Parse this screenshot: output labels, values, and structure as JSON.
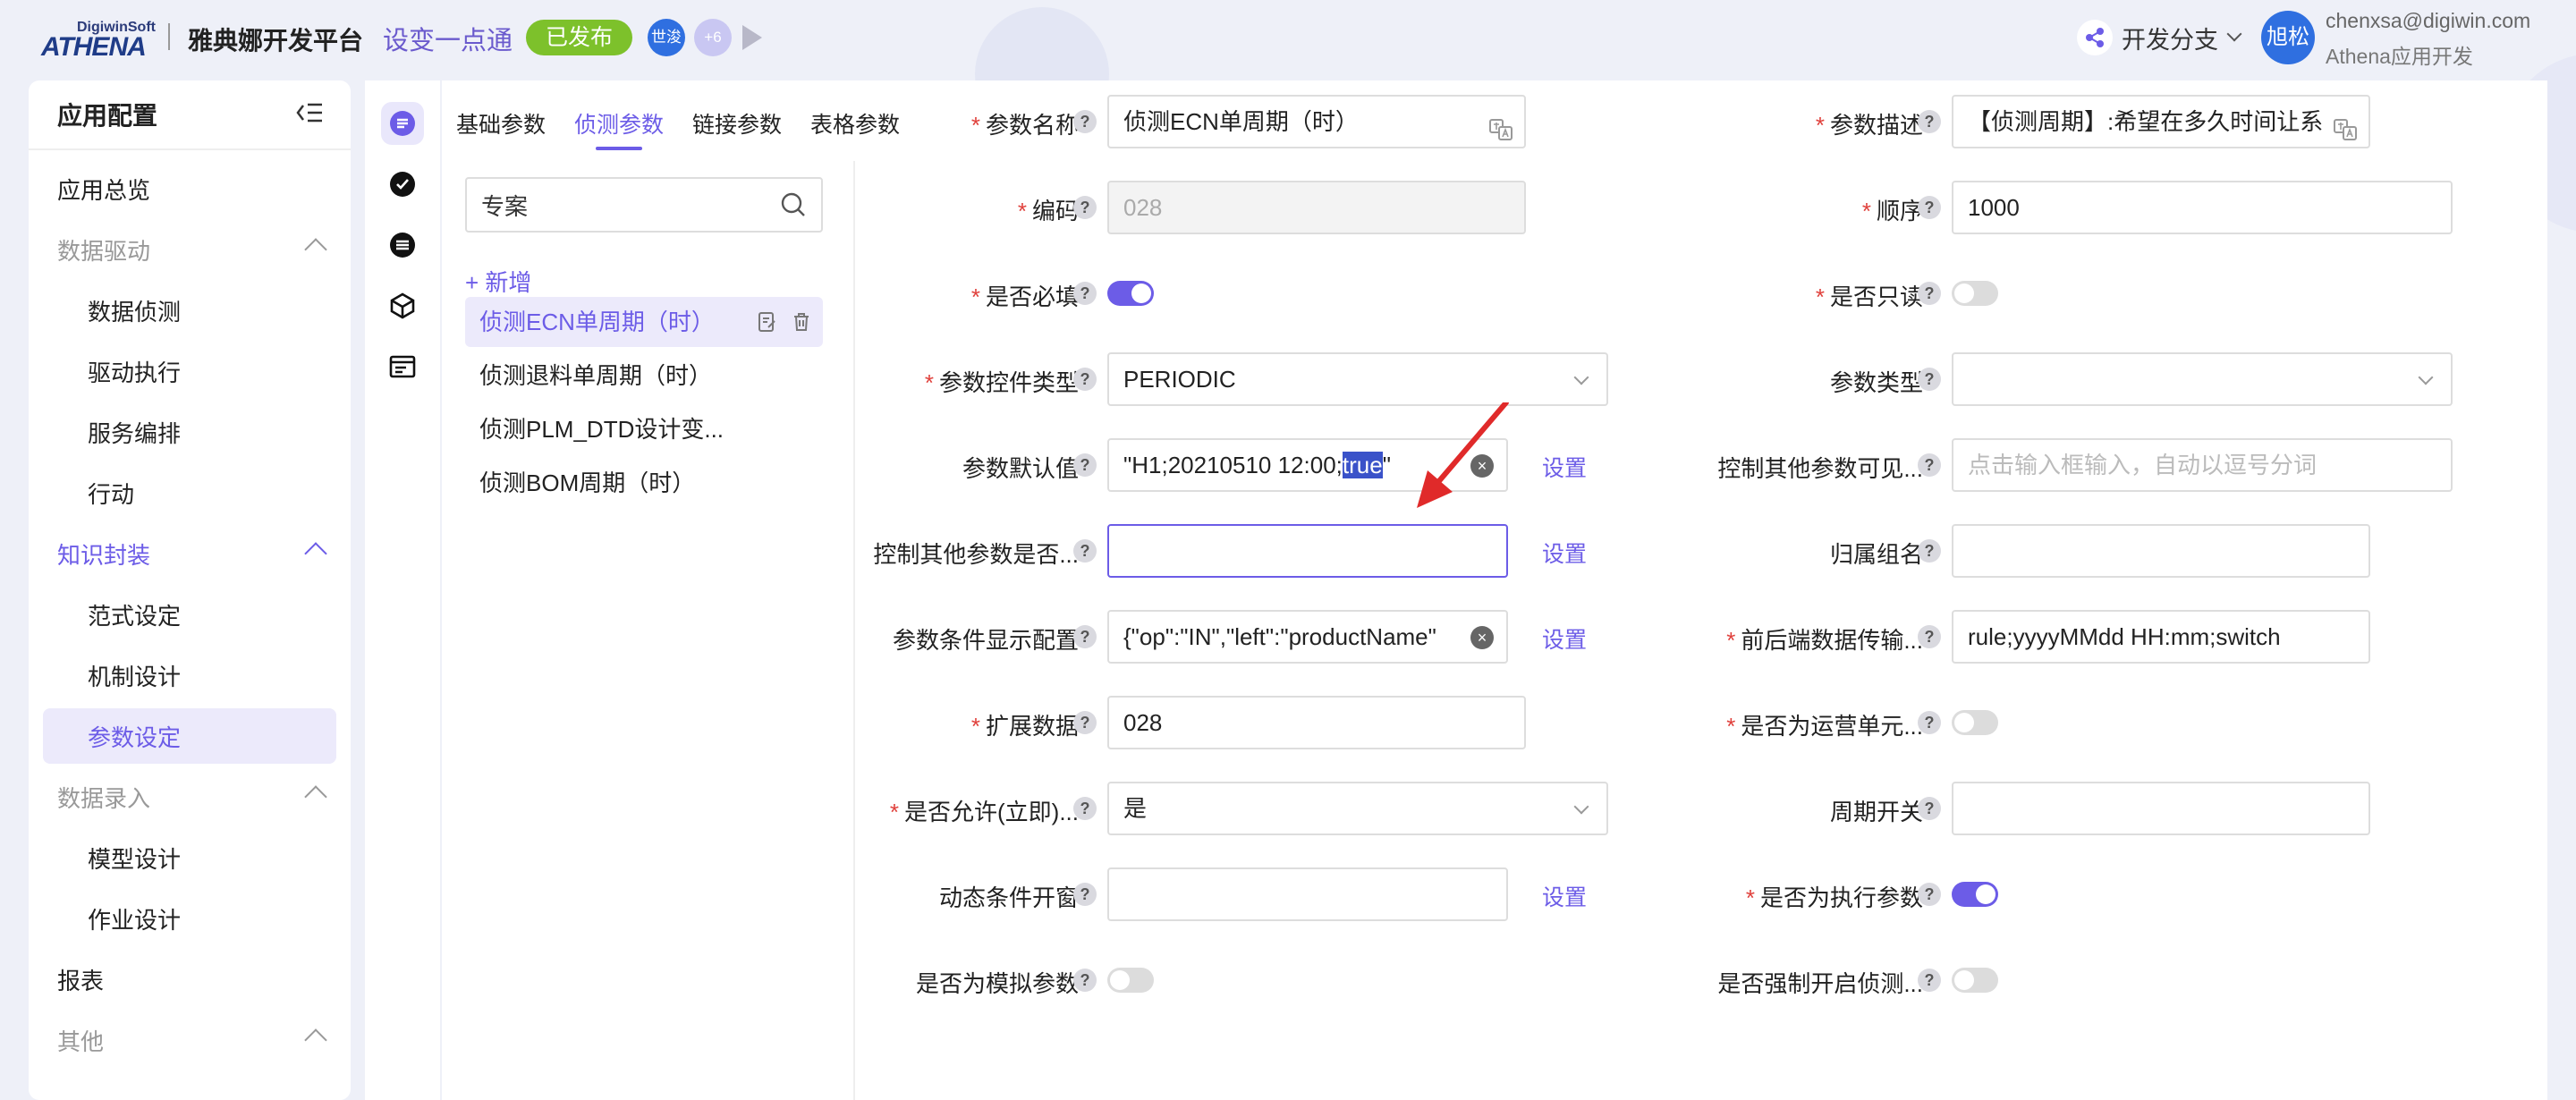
{
  "header": {
    "logo_small": "DigiwinSoft",
    "logo_big": "ATHENA",
    "platform": "雅典娜开发平台",
    "app_name": "设变一点通",
    "status_badge": "已发布",
    "avatar1": "世浚",
    "avatar_more": "+6",
    "branch_label": "开发分支",
    "user_avatar": "旭松",
    "user_email": "chenxsa@digiwin.com",
    "user_role": "Athena应用开发"
  },
  "sidebar": {
    "title": "应用配置",
    "items": [
      {
        "label": "应用总览",
        "kind": "item"
      },
      {
        "label": "数据驱动",
        "kind": "group"
      },
      {
        "label": "数据侦测",
        "kind": "sub"
      },
      {
        "label": "驱动执行",
        "kind": "sub"
      },
      {
        "label": "服务编排",
        "kind": "sub"
      },
      {
        "label": "行动",
        "kind": "sub"
      },
      {
        "label": "知识封装",
        "kind": "group-active"
      },
      {
        "label": "范式设定",
        "kind": "sub"
      },
      {
        "label": "机制设计",
        "kind": "sub"
      },
      {
        "label": "参数设定",
        "kind": "sub-selected"
      },
      {
        "label": "数据录入",
        "kind": "group"
      },
      {
        "label": "模型设计",
        "kind": "sub"
      },
      {
        "label": "作业设计",
        "kind": "sub"
      },
      {
        "label": "报表",
        "kind": "item"
      },
      {
        "label": "其他",
        "kind": "group"
      }
    ]
  },
  "tabs": [
    "基础参数",
    "侦测参数",
    "链接参数",
    "表格参数"
  ],
  "search": {
    "value": "专案"
  },
  "add_label": "+ 新增",
  "params_list": [
    "侦测ECN单周期（时）",
    "侦测退料单周期（时）",
    "侦测PLM_DTD设计变...",
    "侦测BOM周期（时）"
  ],
  "form": {
    "left": [
      {
        "label": "参数名称",
        "required": true,
        "type": "text",
        "value": "侦测ECN单周期（时）",
        "translate": true
      },
      {
        "label": "编码",
        "required": true,
        "type": "disabled",
        "value": "028"
      },
      {
        "label": "是否必填",
        "required": true,
        "type": "toggle",
        "on": true
      },
      {
        "label": "参数控件类型",
        "required": true,
        "type": "select",
        "value": "PERIODIC"
      },
      {
        "label": "参数默认值",
        "required": false,
        "type": "clearable",
        "value_pre": "\"H1;20210510 12:00;",
        "value_hl": "true",
        "value_post": "\"",
        "setting": "设置"
      },
      {
        "label": "控制其他参数是否...",
        "required": false,
        "type": "focus",
        "value": "",
        "setting": "设置"
      },
      {
        "label": "参数条件显示配置",
        "required": false,
        "type": "clearable",
        "value_pre": "{\"op\":\"IN\",\"left\":\"productName\"",
        "value_hl": "",
        "value_post": "",
        "setting": "设置"
      },
      {
        "label": "扩展数据",
        "required": true,
        "type": "text",
        "value": "028"
      },
      {
        "label": "是否允许(立即)...",
        "required": true,
        "type": "select",
        "value": "是"
      },
      {
        "label": "动态条件开窗",
        "required": false,
        "type": "text",
        "value": "",
        "setting": "设置"
      },
      {
        "label": "是否为模拟参数",
        "required": false,
        "type": "toggle",
        "on": false
      }
    ],
    "right": [
      {
        "label": "参数描述",
        "required": true,
        "type": "text",
        "value": "【侦测周期】:希望在多久时间让系",
        "translate": true
      },
      {
        "label": "顺序",
        "required": true,
        "type": "text",
        "value": "1000"
      },
      {
        "label": "是否只读",
        "required": true,
        "type": "toggle",
        "on": false
      },
      {
        "label": "参数类型",
        "required": false,
        "type": "select",
        "value": ""
      },
      {
        "label": "控制其他参数可见...",
        "required": false,
        "type": "placeholder",
        "value": "点击输入框输入，自动以逗号分词"
      },
      {
        "label": "归属组名",
        "required": false,
        "type": "text",
        "value": ""
      },
      {
        "label": "前后端数据传输...",
        "required": true,
        "type": "text",
        "value": "rule;yyyyMMdd HH:mm;switch"
      },
      {
        "label": "是否为运营单元...",
        "required": true,
        "type": "toggle",
        "on": false
      },
      {
        "label": "周期开关",
        "required": false,
        "type": "text",
        "value": ""
      },
      {
        "label": "是否为执行参数",
        "required": true,
        "type": "toggle",
        "on": true
      },
      {
        "label": "是否强制开启侦测...",
        "required": false,
        "type": "toggle",
        "on": false
      }
    ]
  },
  "colors": {
    "accent": "#6c5ce7",
    "published": "#7dc12b",
    "required": "#e0413c",
    "annotation_arrow": "#e02a2a"
  }
}
